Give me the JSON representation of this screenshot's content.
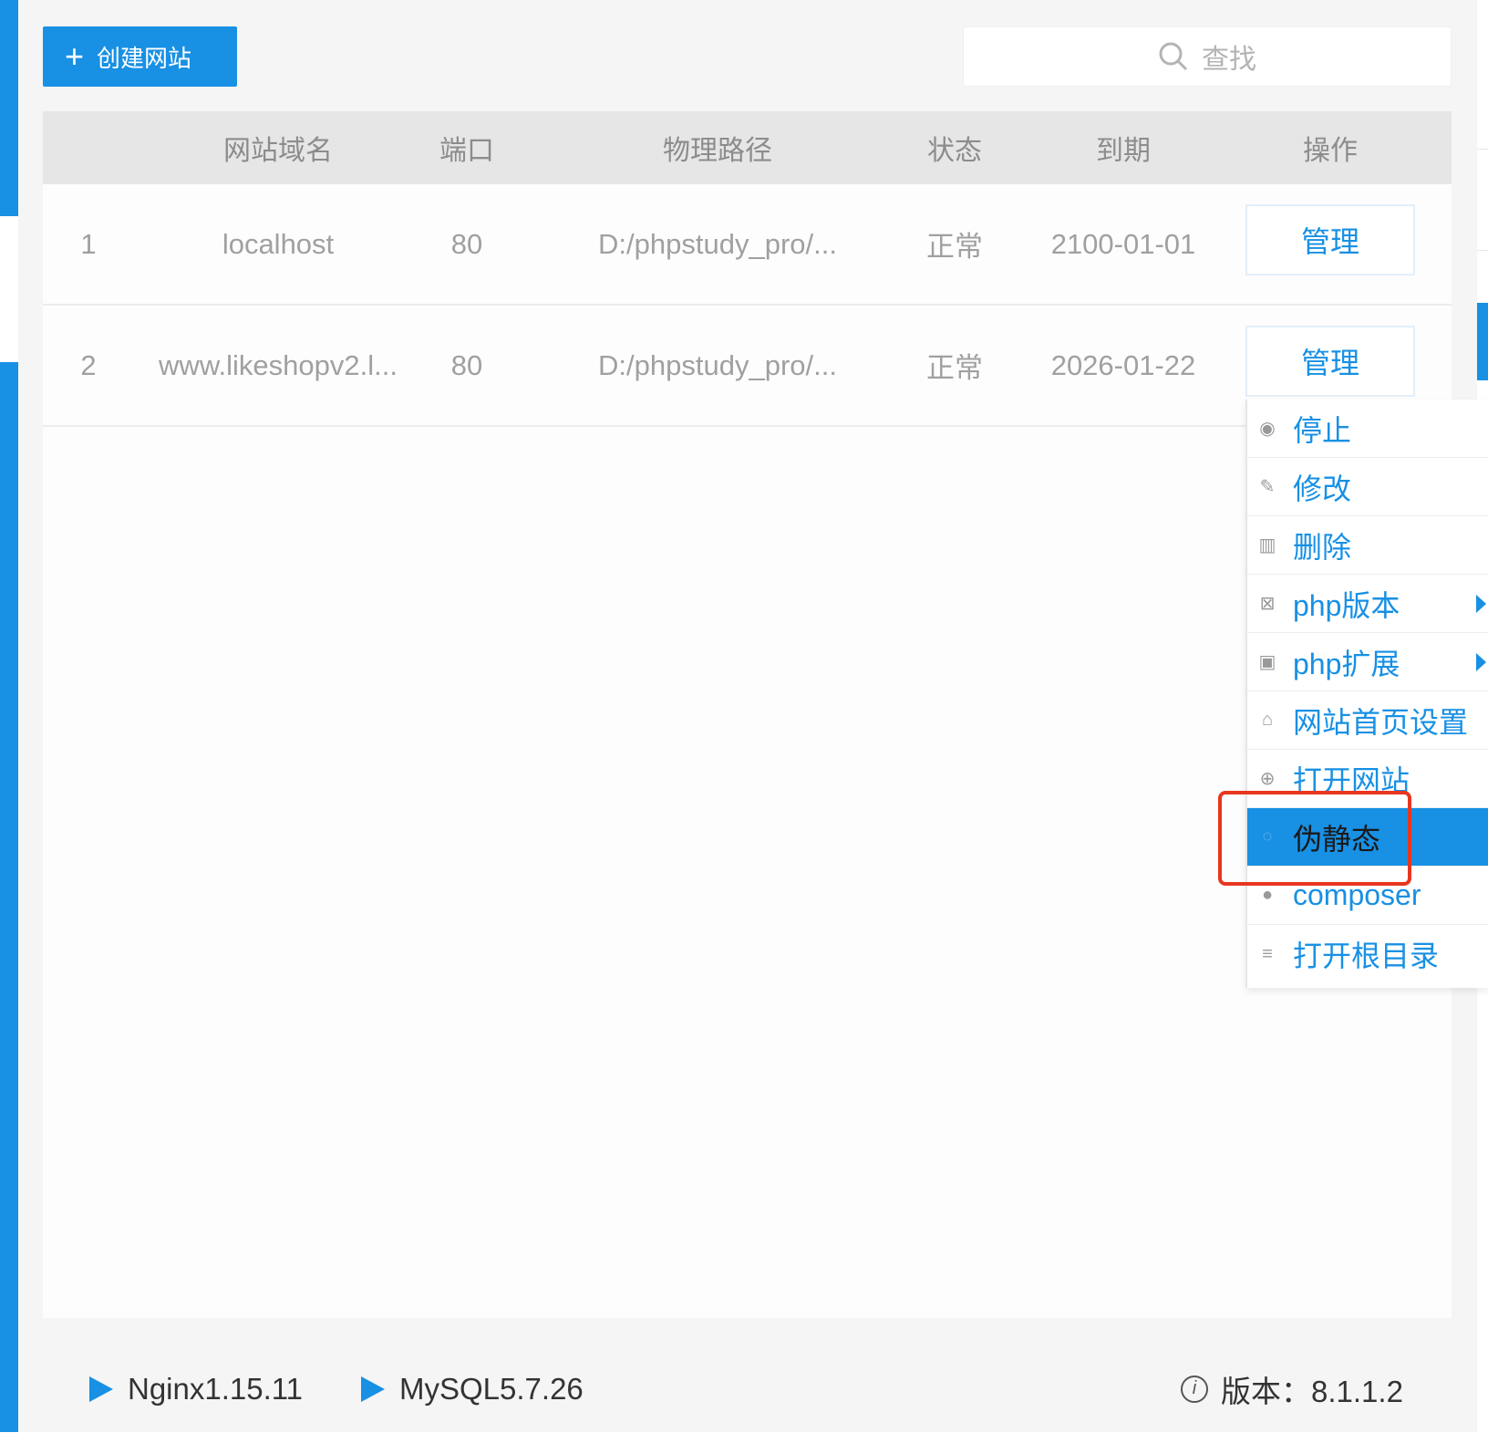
{
  "toolbar": {
    "create_label": "创建网站",
    "search_placeholder": "查找"
  },
  "table": {
    "headers": {
      "domain": "网站域名",
      "port": "端口",
      "path": "物理路径",
      "status": "状态",
      "expire": "到期",
      "action": "操作"
    },
    "rows": [
      {
        "index": "1",
        "domain": "localhost",
        "port": "80",
        "path": "D:/phpstudy_pro/...",
        "status": "正常",
        "expire": "2100-01-01",
        "action": "管理"
      },
      {
        "index": "2",
        "domain": "www.likeshopv2.l...",
        "port": "80",
        "path": "D:/phpstudy_pro/...",
        "status": "正常",
        "expire": "2026-01-22",
        "action": "管理"
      }
    ]
  },
  "menu": {
    "items": [
      {
        "label": "停止",
        "icon": "stop-icon"
      },
      {
        "label": "修改",
        "icon": "pencil-icon"
      },
      {
        "label": "删除",
        "icon": "trash-icon"
      },
      {
        "label": "php版本",
        "icon": "php-version-icon",
        "submenu": true
      },
      {
        "label": "php扩展",
        "icon": "php-extension-icon",
        "submenu": true
      },
      {
        "label": "网站首页设置",
        "icon": "home-icon"
      },
      {
        "label": "打开网站",
        "icon": "globe-icon"
      },
      {
        "label": "伪静态",
        "icon": "rewrite-icon",
        "active": true
      },
      {
        "label": "composer",
        "icon": "composer-icon"
      },
      {
        "label": "打开根目录",
        "icon": "list-icon"
      }
    ]
  },
  "footer": {
    "nginx": "Nginx1.15.11",
    "mysql": "MySQL5.7.26",
    "version": "版本：8.1.1.2"
  },
  "colors": {
    "accent": "#1890e4",
    "highlight": "#e8361f"
  }
}
